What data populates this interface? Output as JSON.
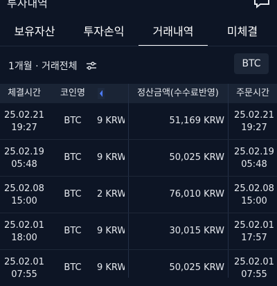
{
  "header": {
    "title": "투자내역"
  },
  "tabs": [
    {
      "label": "보유자산",
      "active": false
    },
    {
      "label": "투자손익",
      "active": false
    },
    {
      "label": "거래내역",
      "active": true
    },
    {
      "label": "미체결",
      "active": false
    }
  ],
  "filter": {
    "text": "1개월 · 거래전체",
    "coin_button": "BTC"
  },
  "table": {
    "headers": [
      "체결시간",
      "코인명",
      "정산금액(수수료반영)",
      "주문시간"
    ],
    "rows": [
      {
        "exec_date": "25.02.21",
        "exec_time": "19:27",
        "coin": "BTC",
        "partial": "9 KRW",
        "amount": "51,169 KRW",
        "order_date": "25.02.21",
        "order_time": "19:27"
      },
      {
        "exec_date": "25.02.19",
        "exec_time": "05:48",
        "coin": "BTC",
        "partial": "9 KRW",
        "amount": "50,025 KRW",
        "order_date": "25.02.19",
        "order_time": "05:48"
      },
      {
        "exec_date": "25.02.08",
        "exec_time": "15:00",
        "coin": "BTC",
        "partial": "2 KRW",
        "amount": "76,010 KRW",
        "order_date": "25.02.08",
        "order_time": "15:00"
      },
      {
        "exec_date": "25.02.01",
        "exec_time": "18:00",
        "coin": "BTC",
        "partial": "9 KRW",
        "amount": "30,015 KRW",
        "order_date": "25.02.01",
        "order_time": "17:57"
      },
      {
        "exec_date": "25.02.01",
        "exec_time": "07:55",
        "coin": "BTC",
        "partial": "9 KRW",
        "amount": "50,025 KRW",
        "order_date": "25.02.01",
        "order_time": "07:55"
      }
    ]
  },
  "colors": {
    "background": "#0d1525",
    "header_bg": "#1a2435",
    "button_bg": "#1c2637",
    "text": "#e6e9ee",
    "divider": "#243047"
  },
  "icons": {
    "filter": "sliders-icon",
    "message": "chat-icon",
    "scroll": "scroll-left-arrow-icon"
  }
}
